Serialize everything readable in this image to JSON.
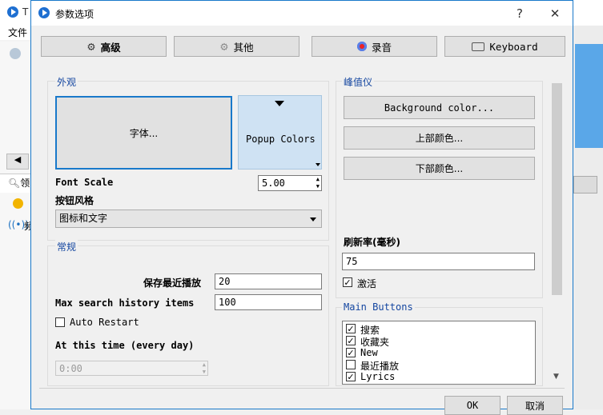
{
  "bg_app": {
    "menu_file": "文件",
    "title_initial": "T",
    "left_letter": "领",
    "left_item": "频"
  },
  "dialog": {
    "title": "参数选项",
    "help": "?",
    "close": "✕",
    "tabs": [
      {
        "label": "高级",
        "icon": "gear-icon"
      },
      {
        "label": "其他",
        "icon": "cog-icon"
      },
      {
        "label": "录音",
        "icon": "record-icon"
      },
      {
        "label": "Keyboard",
        "icon": "keyboard-icon"
      }
    ],
    "appearance": {
      "title": "外观",
      "font_button": "字体...",
      "popup_colors": "Popup Colors",
      "font_scale_label": "Font Scale",
      "font_scale_value": "5.00",
      "button_style_label": "按钮风格",
      "button_style_value": "图标和文字"
    },
    "general": {
      "title": "常规",
      "save_recent_label": "保存最近播放",
      "save_recent_value": "20",
      "max_history_label": "Max search history items",
      "max_history_value": "100",
      "auto_restart_label": "Auto Restart",
      "at_this_time_label": "At this time (every day)",
      "time_value": "0:00"
    },
    "peak": {
      "title": "峰值仪",
      "background_color": "Background color...",
      "top_color": "上部颜色...",
      "bottom_color": "下部颜色...",
      "refresh_label": "刷新率(毫秒)",
      "refresh_value": "75",
      "activate_label": "激活"
    },
    "main_buttons": {
      "title": "Main Buttons",
      "items": [
        {
          "label": "搜索",
          "checked": true
        },
        {
          "label": "收藏夹",
          "checked": true
        },
        {
          "label": "New",
          "checked": true
        },
        {
          "label": "最近播放",
          "checked": false
        },
        {
          "label": "Lyrics",
          "checked": true
        }
      ]
    },
    "ok": "OK",
    "cancel": "取消"
  },
  "colors": {
    "accent": "#1979ca",
    "popup_bg": "#cfe2f3",
    "group_title": "#1446a0"
  }
}
